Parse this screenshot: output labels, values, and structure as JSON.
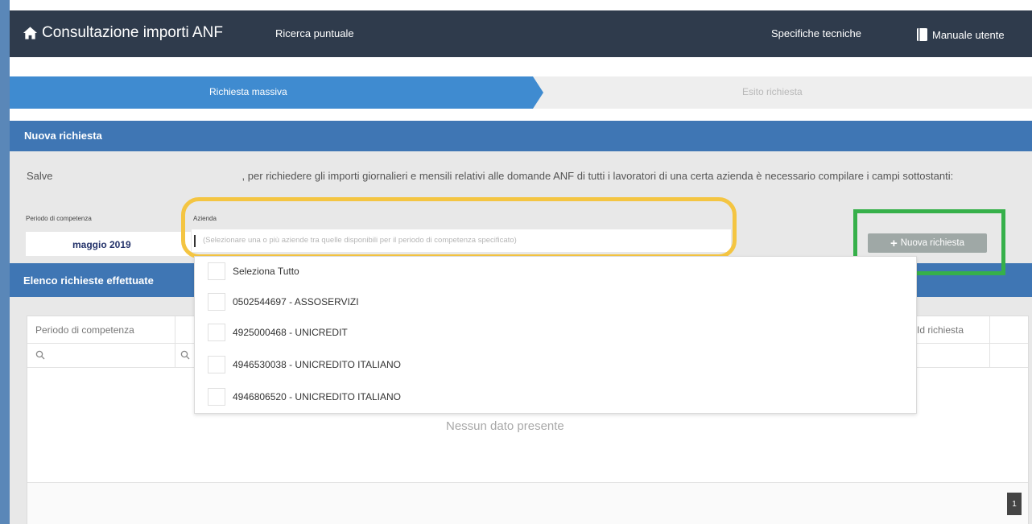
{
  "header": {
    "app_title": "Consultazione importi ANF",
    "nav": {
      "ricerca": "Ricerca puntuale",
      "specifiche": "Specifiche tecniche",
      "manuale": "Manuale utente"
    },
    "bg_color": "#2f3b4c"
  },
  "steps": {
    "step1": "Richiesta massiva",
    "step2": "Esito richiesta",
    "active_color": "#3f8bd0"
  },
  "form": {
    "section_title": "Nuova richiesta",
    "intro_greeting": "Salve",
    "intro_text": ", per richiedere gli importi giornalieri e mensili relativi alle domande ANF di tutti i lavoratori di una certa azienda è necessario compilare i campi sottostanti:",
    "periodo_label": "Periodo di competenza",
    "periodo_value": "maggio 2019",
    "azienda_label": "Azienda",
    "azienda_placeholder": "(Selezionare una o più aziende tra quelle disponibili per il periodo di competenza specificato)",
    "new_request_button": "Nuova richiesta"
  },
  "dropdown": {
    "items": [
      {
        "label": "Seleziona Tutto",
        "checked": false
      },
      {
        "label": "0502544697 - ASSOSERVIZI",
        "checked": false
      },
      {
        "label": "4925000468 - UNICREDIT",
        "checked": false
      },
      {
        "label": "4946530038 - UNICREDITO ITALIANO",
        "checked": false
      },
      {
        "label": "4946806520 - UNICREDITO ITALIANO",
        "checked": false
      }
    ]
  },
  "elenco": {
    "title": "Elenco richieste effettuate",
    "columns": {
      "periodo": "Periodo di competenza",
      "id": "Id richiesta"
    },
    "empty_text": "Nessun dato presente",
    "page": "1"
  },
  "annotations": {
    "yellow_color": "#f4c542",
    "green_color": "#36b04a"
  }
}
